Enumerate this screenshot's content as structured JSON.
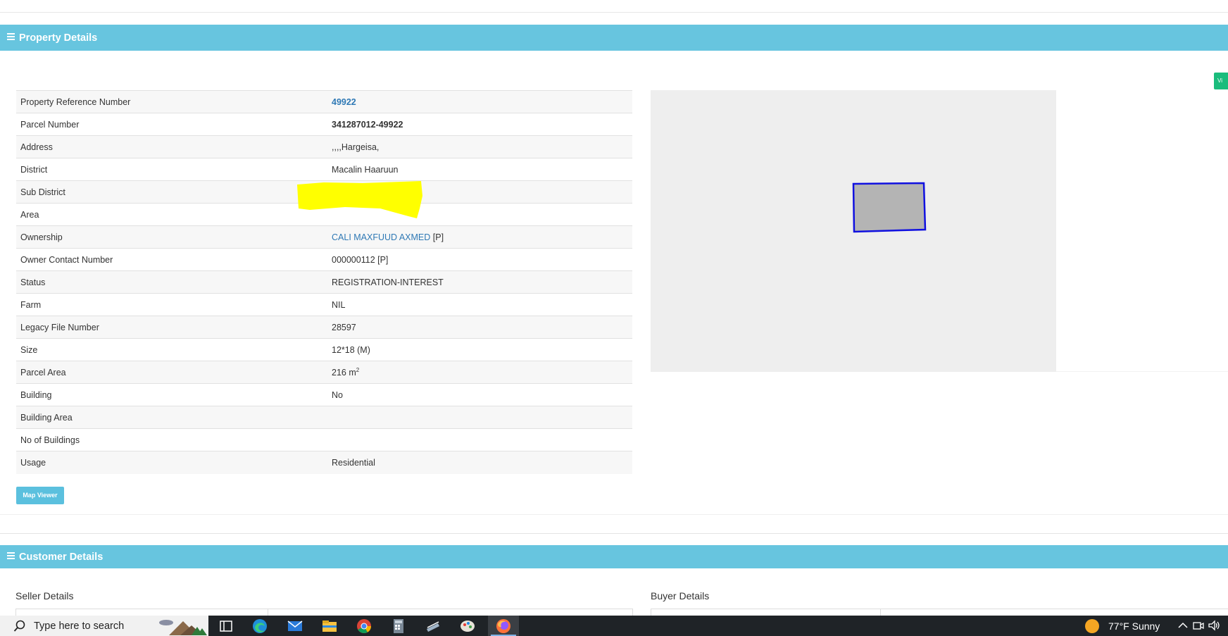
{
  "property_section": {
    "title": "Property Details",
    "rows": [
      {
        "label": "Property Reference Number",
        "value": "49922"
      },
      {
        "label": "Parcel Number",
        "value": "341287012-49922"
      },
      {
        "label": "Address",
        "value": ",,,,Hargeisa,"
      },
      {
        "label": "District",
        "value": "Macalin Haaruun"
      },
      {
        "label": "Sub District",
        "value": ""
      },
      {
        "label": "Area",
        "value": ""
      },
      {
        "label": "Ownership",
        "value": "CALI MAXFUUD AXMED",
        "suffix": " [P]"
      },
      {
        "label": "Owner Contact Number",
        "value": "000000112 [P]"
      },
      {
        "label": "Status",
        "value": "REGISTRATION-INTEREST"
      },
      {
        "label": "Farm",
        "value": "NIL"
      },
      {
        "label": "Legacy File Number",
        "value": "28597"
      },
      {
        "label": "Size",
        "value": "12*18 (M)"
      },
      {
        "label": "Parcel Area",
        "value": "216 m",
        "sup": "2"
      },
      {
        "label": "Building",
        "value": "No"
      },
      {
        "label": "Building Area",
        "value": ""
      },
      {
        "label": "No of Buildings",
        "value": ""
      },
      {
        "label": "Usage",
        "value": "Residential"
      }
    ],
    "view_button_label": "Vi",
    "map_viewer_label": "Map Viewer"
  },
  "customer_section": {
    "title": "Customer Details",
    "seller_title": "Seller Details",
    "buyer_title": "Buyer Details"
  },
  "taskbar": {
    "search_placeholder": "Type here to search",
    "weather": "77°F  Sunny"
  },
  "colors": {
    "section_header": "#67c5df",
    "link": "#2f79b5",
    "view_button": "#1abc7c",
    "parcel_stroke": "#1010e0",
    "parcel_fill": "#b4b4b4",
    "highlight": "#ffff00"
  },
  "icons": [
    "list-icon",
    "search-icon",
    "task-view-icon",
    "edge-icon",
    "mail-icon",
    "file-explorer-icon",
    "chrome-icon",
    "calculator-icon",
    "scanner-icon",
    "paint-icon",
    "firefox-icon",
    "sun-icon",
    "chevron-up-icon",
    "speaker-icon"
  ]
}
